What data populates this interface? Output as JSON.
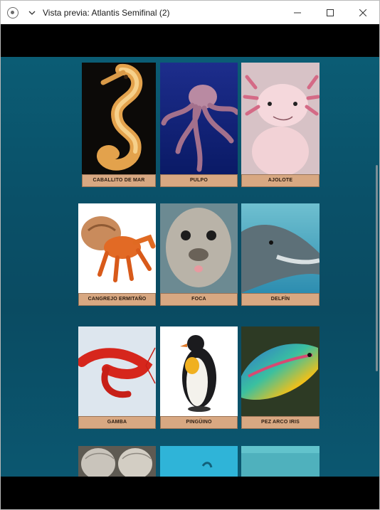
{
  "window": {
    "title": "Vista previa: Atlantis Semifinal (2)",
    "icons": [
      "app-icon",
      "chevron-down-icon",
      "minimize-icon",
      "maximize-icon",
      "close-icon"
    ]
  },
  "colors": {
    "stage_top": "#0b5c74",
    "stage_bottom": "#0a4b62",
    "label_bg": "#d8a882"
  },
  "cards": [
    {
      "label": "CABALLITO DE MAR"
    },
    {
      "label": "PULPO"
    },
    {
      "label": "AJOLOTE"
    },
    {
      "label": "CANGREJO ERMITAÑO"
    },
    {
      "label": "FOCA"
    },
    {
      "label": "DELFÍN"
    },
    {
      "label": "GAMBA"
    },
    {
      "label": "PINGÜINO"
    },
    {
      "label": "PEZ ARCO IRIS"
    }
  ]
}
